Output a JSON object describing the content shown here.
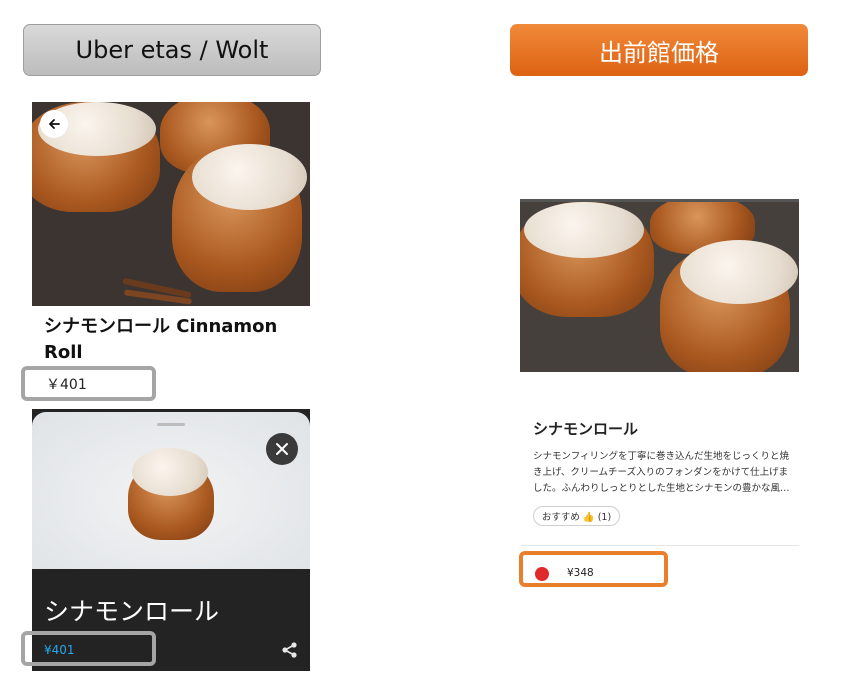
{
  "headers": {
    "left": "Uber etas / Wolt",
    "right": "出前館価格"
  },
  "wolt": {
    "product_title": "シナモンロール Cinnamon Roll",
    "price": "￥401",
    "back_icon": "arrow-left-icon"
  },
  "uber": {
    "product_title": "シナモンロール",
    "price": "¥401",
    "close_icon": "close-icon",
    "share_icon": "share-icon"
  },
  "demaecan": {
    "product_title": "シナモンロール",
    "description": "シナモンフィリングを丁寧に巻き込んだ生地をじっくりと焼き上げ、クリームチーズ入りのフォンダンをかけて仕上げました。ふんわりしっとりとした生地とシナモンの豊かな風…",
    "recommend_label": "おすすめ 👍 (1)",
    "price": "¥348"
  },
  "colors": {
    "orange_header": "#e8782a",
    "gray_header": "#c8c8c8",
    "uber_price_blue": "#2aa5e8",
    "highlight_orange": "#e97e2d",
    "highlight_gray": "#a5a5a5",
    "red_dot": "#e02a2a"
  }
}
